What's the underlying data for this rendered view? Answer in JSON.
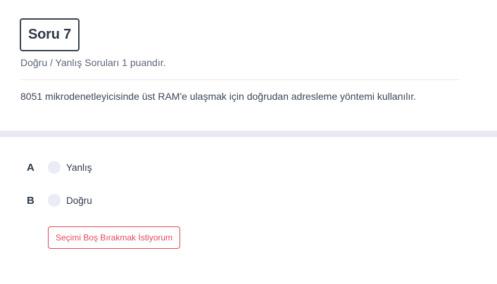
{
  "question": {
    "badge": "Soru 7",
    "subtitle": "Doğru / Yanlış Soruları 1 puandır.",
    "text": "8051 mikrodenetleyicisinde üst RAM'e ulaşmak için doğrudan adresleme yöntemi kullanılır."
  },
  "options": [
    {
      "letter": "A",
      "label": "Yanlış"
    },
    {
      "letter": "B",
      "label": "Doğru"
    }
  ],
  "skip_button": "Seçimi Boş Bırakmak İstiyorum",
  "colors": {
    "badge_border": "#3a4453",
    "separator": "#e8e9f3",
    "radio_fill": "#e9edf3",
    "skip_accent": "#e04a59"
  }
}
